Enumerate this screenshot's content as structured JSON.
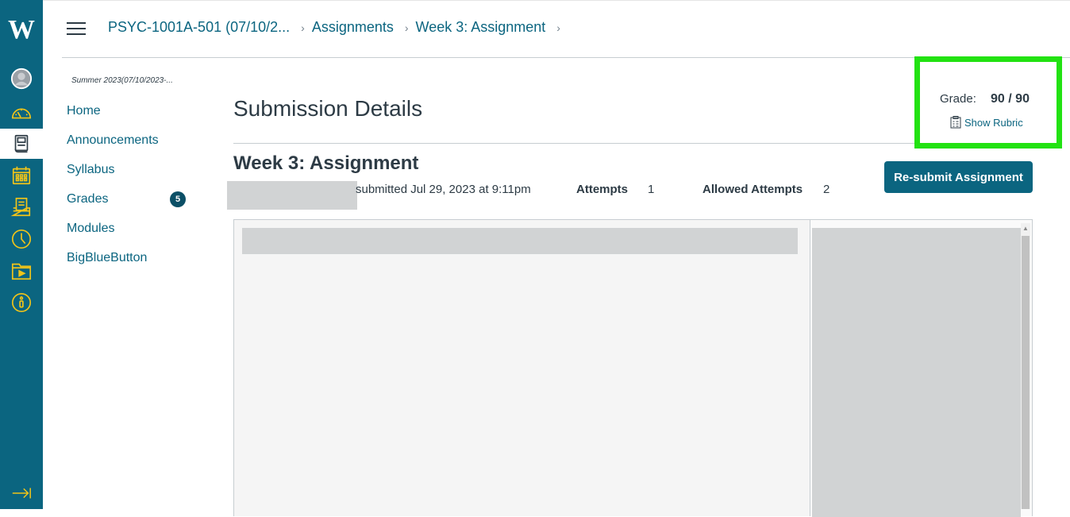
{
  "global_nav": {
    "logo": "W",
    "items": [
      {
        "name": "account",
        "icon": "avatar-icon"
      },
      {
        "name": "dashboard",
        "icon": "dashboard-icon"
      },
      {
        "name": "courses",
        "icon": "courses-icon",
        "active": true
      },
      {
        "name": "calendar",
        "icon": "calendar-icon"
      },
      {
        "name": "inbox",
        "icon": "inbox-icon"
      },
      {
        "name": "history",
        "icon": "clock-icon"
      },
      {
        "name": "studio",
        "icon": "studio-icon"
      },
      {
        "name": "help",
        "icon": "help-icon"
      }
    ],
    "collapse_icon": "collapse-icon"
  },
  "breadcrumb": {
    "course": "PSYC-1001A-501 (07/10/2...",
    "section": "Assignments",
    "page": "Week 3: Assignment"
  },
  "course_nav": {
    "term": "Summer 2023(07/10/2023-...",
    "items": [
      {
        "label": "Home"
      },
      {
        "label": "Announcements"
      },
      {
        "label": "Syllabus"
      },
      {
        "label": "Grades",
        "badge": "5"
      },
      {
        "label": "Modules"
      },
      {
        "label": "BigBlueButton"
      }
    ]
  },
  "main": {
    "page_title": "Submission Details",
    "assignment_title": "Week 3: Assignment",
    "submitted_text": "submitted Jul 29, 2023 at 9:11pm",
    "attempts_label": "Attempts",
    "attempts_value": "1",
    "allowed_attempts_label": "Allowed Attempts",
    "allowed_attempts_value": "2",
    "resubmit_label": "Re-submit Assignment"
  },
  "grade": {
    "label": "Grade:",
    "value": "90 / 90",
    "rubric_link": "Show Rubric",
    "highlight_color": "#22e212"
  },
  "colors": {
    "brand": "#0b6580",
    "nav_icon": "#f0c419"
  }
}
